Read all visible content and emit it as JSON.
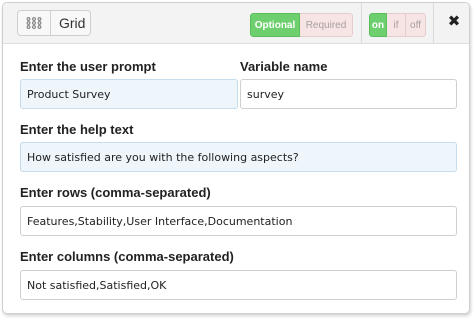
{
  "header": {
    "grid_label": "Grid",
    "grid_icon": "grid-icon",
    "requirement_options": [
      "Optional",
      "Required"
    ],
    "requirement_selected": "Optional",
    "state_options": [
      "on",
      "if",
      "off"
    ],
    "state_selected": "on",
    "close_icon": "close-icon",
    "close_glyph": "✖"
  },
  "form": {
    "prompt_label": "Enter the user prompt",
    "prompt_value": "Product Survey",
    "variable_label": "Variable name",
    "variable_value": "survey",
    "help_label": "Enter the help text",
    "help_value": "How satisfied are you with the following aspects?",
    "rows_label": "Enter rows (comma-separated)",
    "rows_value": "Features,Stability,User Interface,Documentation",
    "columns_label": "Enter columns (comma-separated)",
    "columns_value": "Not satisfied,Satisfied,OK"
  },
  "colors": {
    "active_green": "#6ecf6e",
    "inactive_pink": "#f7e4e4",
    "focused_field_bg": "#eef6fc"
  }
}
